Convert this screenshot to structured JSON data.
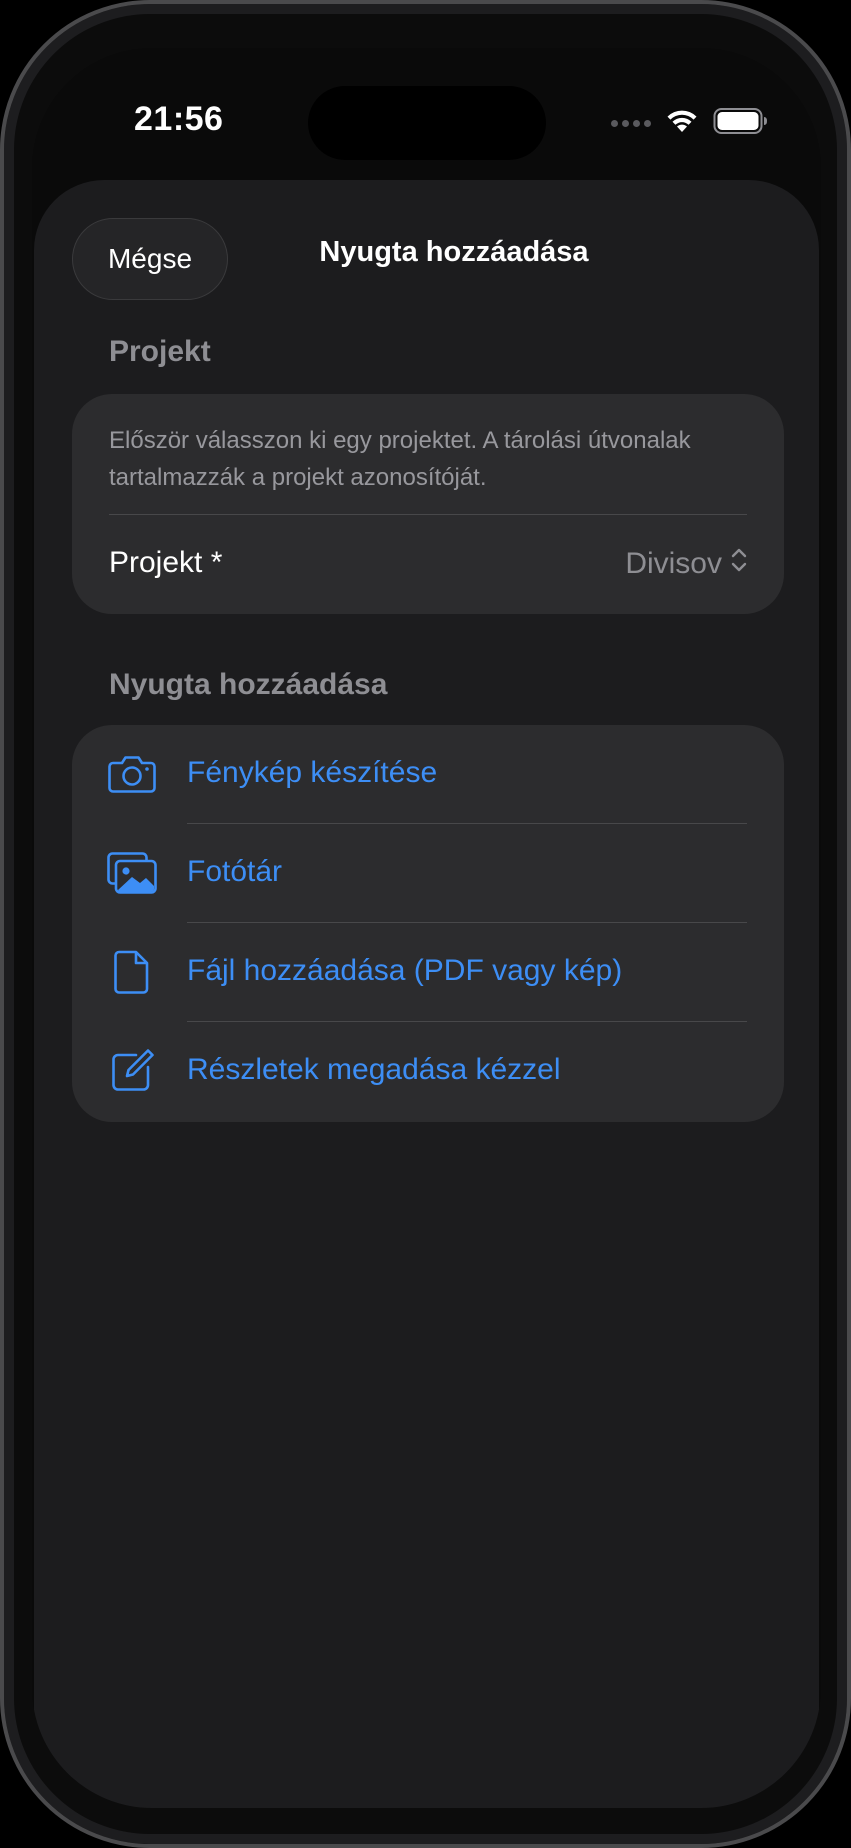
{
  "status_bar": {
    "time": "21:56",
    "icons": [
      "cellular-signal-icon",
      "wifi-icon",
      "battery-icon"
    ]
  },
  "sheet": {
    "cancel_label": "Mégse",
    "title": "Nyugta hozzáadása"
  },
  "project_section": {
    "header": "Projekt",
    "hint": "Először válasszon ki egy projektet. A tárolási útvonalak tartalmazzák a projekt azonosítóját.",
    "field_label": "Projekt *",
    "selected_value": "Divisov"
  },
  "add_section": {
    "header": "Nyugta hozzáadása",
    "actions": [
      {
        "label": "Fénykép készítése",
        "icon": "camera-icon"
      },
      {
        "label": "Fotótár",
        "icon": "photo-library-icon"
      },
      {
        "label": "Fájl hozzáadása (PDF vagy kép)",
        "icon": "document-icon"
      },
      {
        "label": "Részletek megadása kézzel",
        "icon": "compose-icon"
      }
    ]
  },
  "colors": {
    "accent": "#3d8ef5",
    "background": "#1c1c1e",
    "card": "#2c2c2e",
    "secondary_text": "#8e8e93"
  }
}
